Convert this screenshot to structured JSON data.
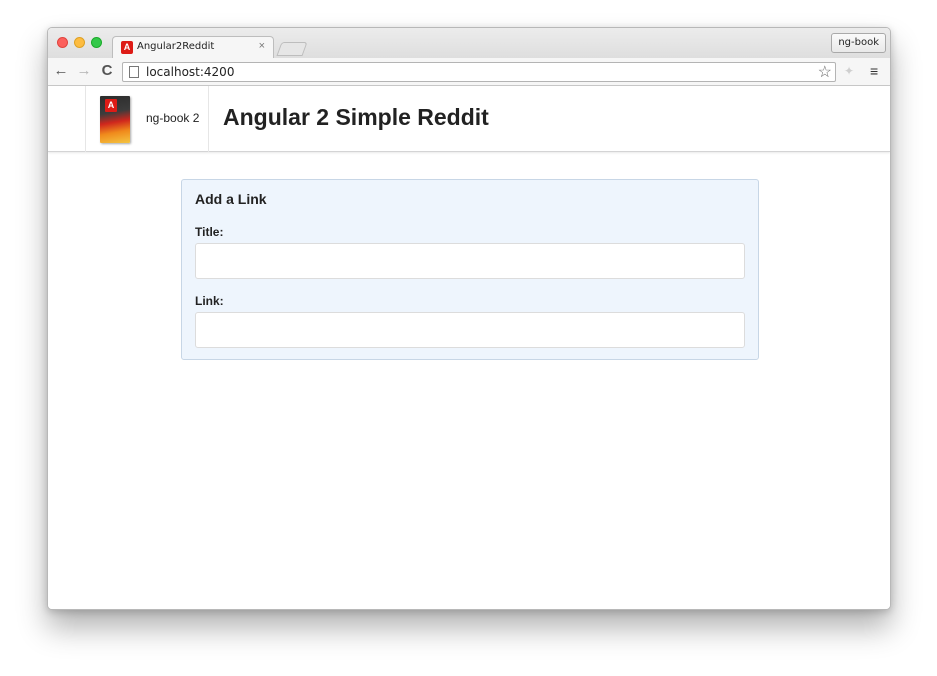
{
  "browser": {
    "tab_title": "Angular2Reddit",
    "tab_close": "×",
    "profile_label": "ng-book",
    "url": "localhost:4200",
    "nav": {
      "back": "←",
      "forward": "→",
      "reload": "C"
    },
    "star": "☆",
    "menu": "≡"
  },
  "header": {
    "brand_label": "ng-book 2",
    "logo_letter": "A",
    "title": "Angular 2 Simple Reddit"
  },
  "form": {
    "heading": "Add a Link",
    "title_label": "Title:",
    "title_value": "",
    "link_label": "Link:",
    "link_value": ""
  }
}
